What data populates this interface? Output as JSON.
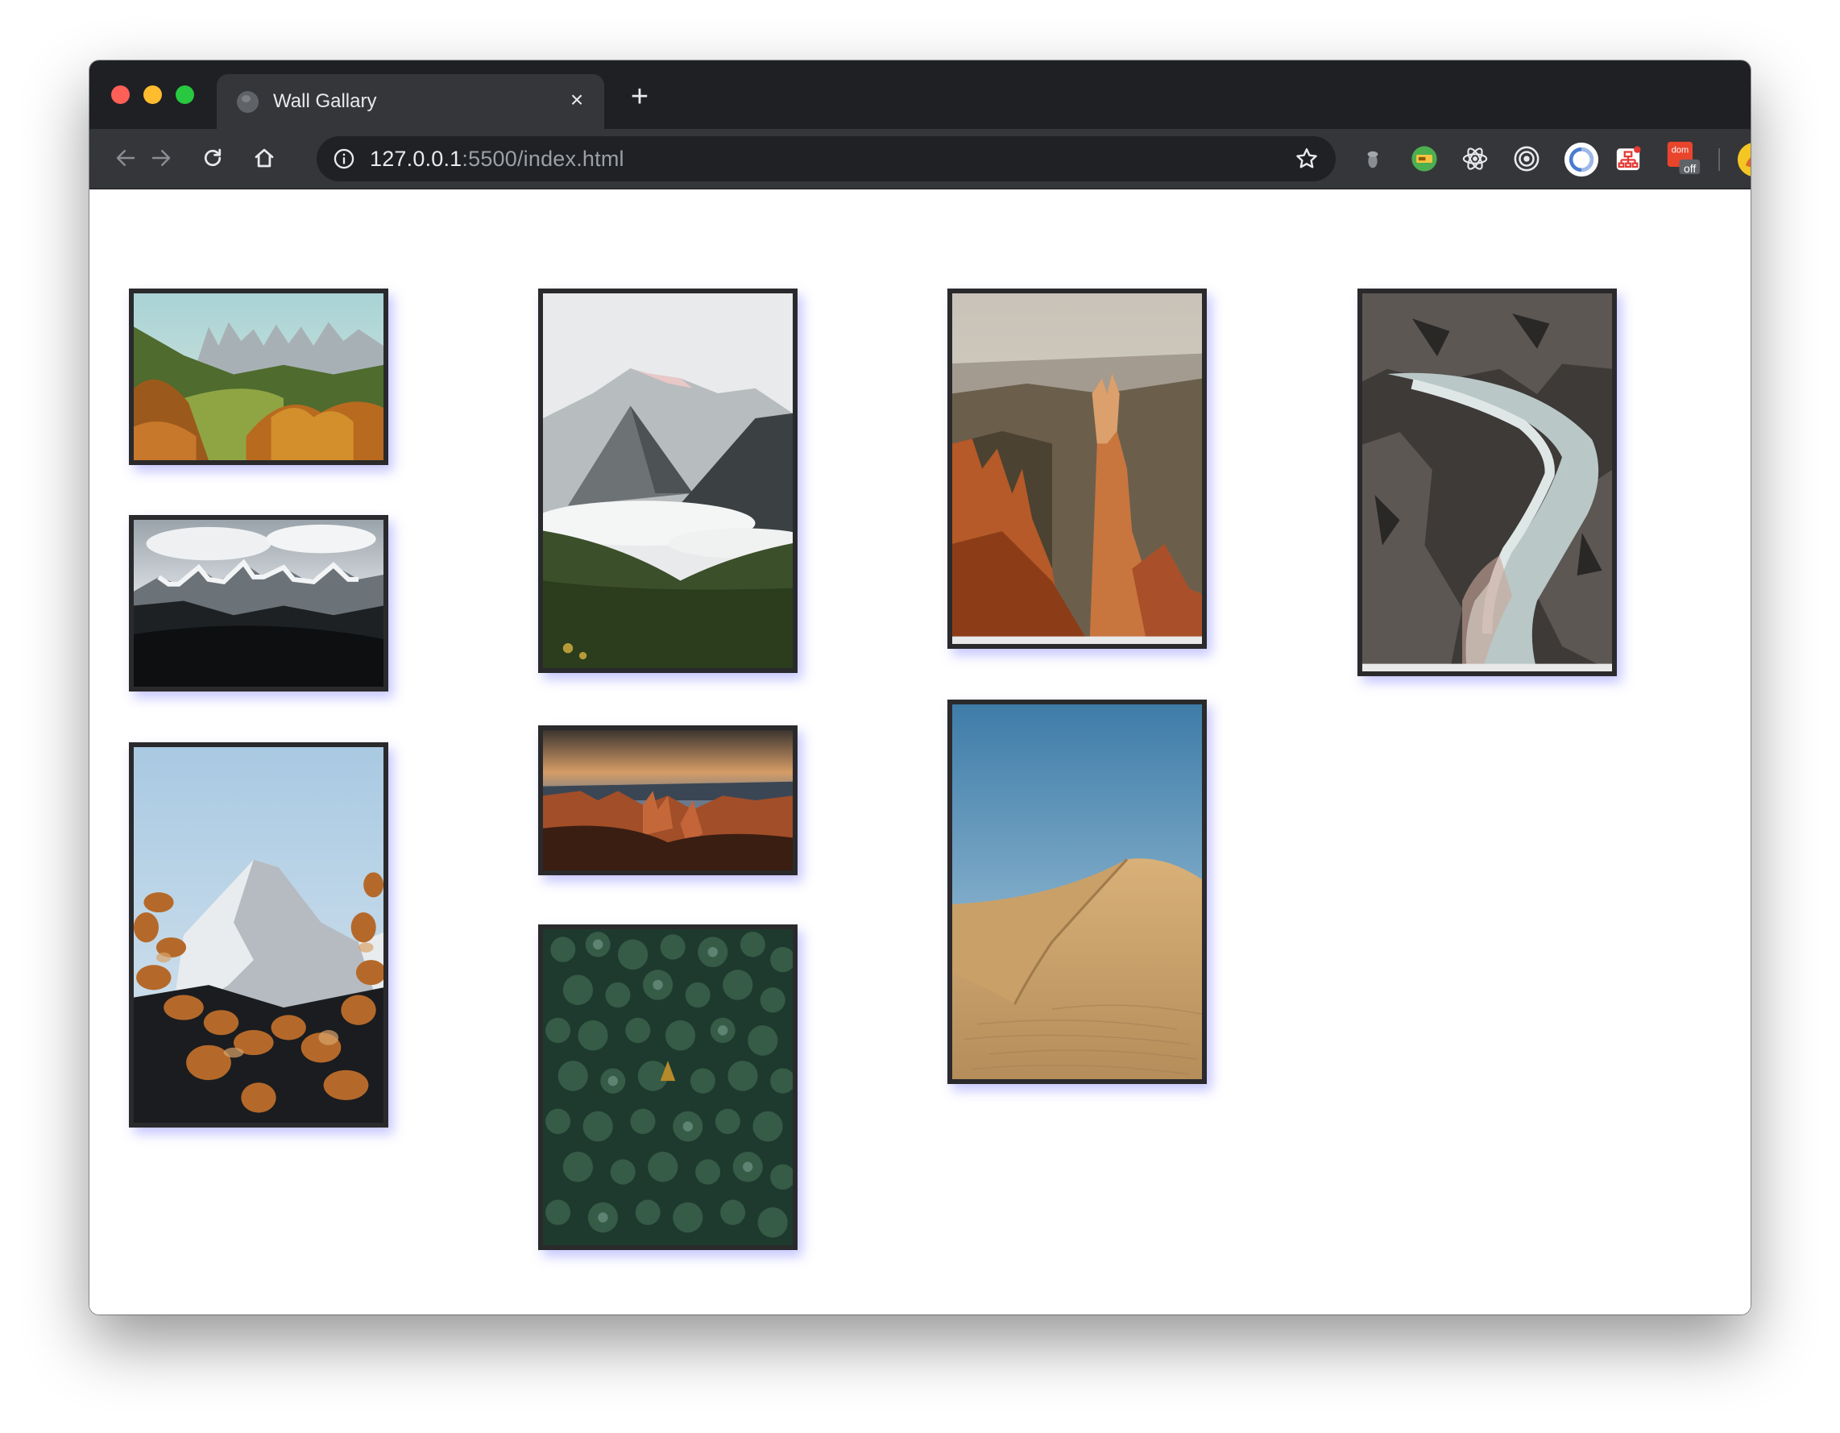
{
  "browser": {
    "tab": {
      "title": "Wall Gallary",
      "close_symbol": "×"
    },
    "new_tab_symbol": "+",
    "address_bar": {
      "host": "127.0.0.1",
      "port_and_path": ":5500/index.html"
    },
    "extension_badge": "off"
  },
  "gallery": {
    "columns": [
      {
        "photos": [
          "autumn-valley-with-peaks",
          "snowy-mountains-cloudy-sky",
          "snowcapped-peak-behind-autumn-leaves"
        ]
      },
      {
        "photos": [
          "misty-mountain-valley-forest",
          "canyon-hoodoos-at-sunset",
          "aerial-pine-forest"
        ]
      },
      {
        "photos": [
          "red-rock-canyon-spire",
          "sand-dune-under-blue-sky"
        ]
      },
      {
        "photos": [
          "rocky-gorge-with-river"
        ]
      }
    ]
  },
  "colors": {
    "titlebar": "#1f2024",
    "toolbar": "#35363a",
    "frame_border": "#2a2a2c",
    "frame_shadow": "#8080ff"
  }
}
